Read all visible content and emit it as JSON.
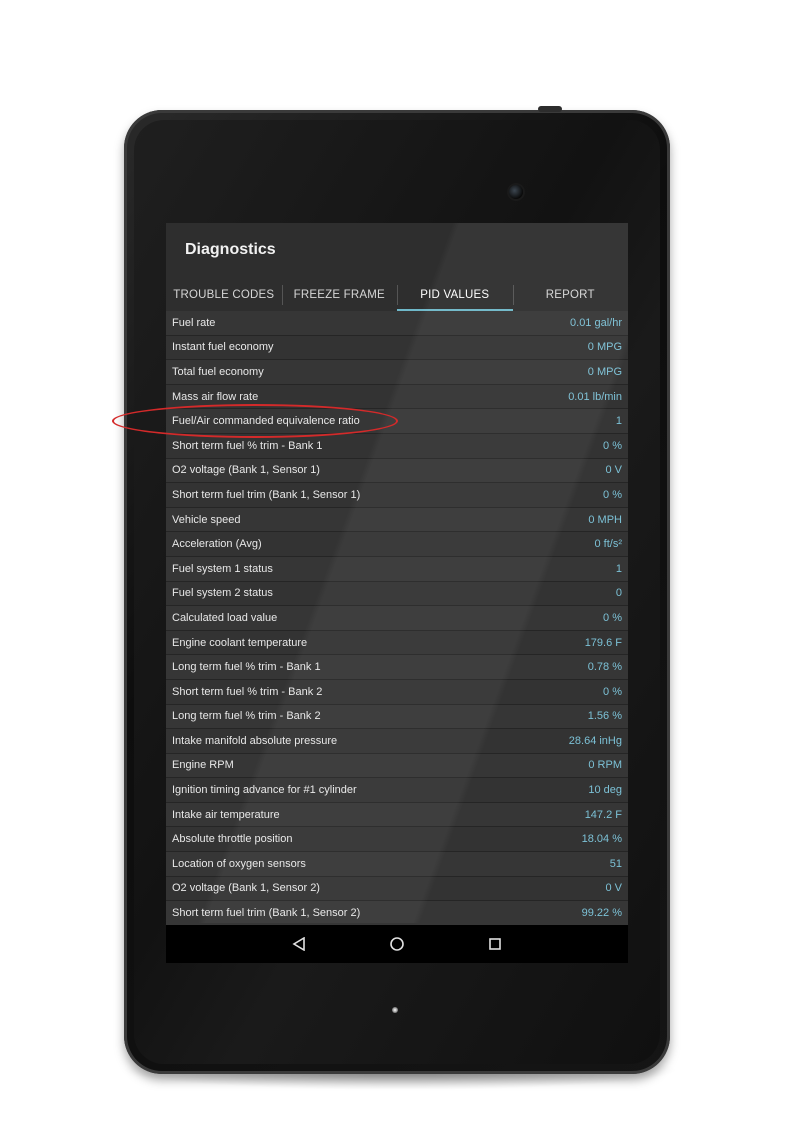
{
  "app": {
    "title": "Diagnostics"
  },
  "tabs": [
    {
      "label": "TROUBLE CODES",
      "active": false
    },
    {
      "label": "FREEZE FRAME",
      "active": false
    },
    {
      "label": "PID VALUES",
      "active": true
    },
    {
      "label": "REPORT",
      "active": false
    }
  ],
  "pid_rows": [
    {
      "label": "Fuel rate",
      "value": "0.01 gal/hr"
    },
    {
      "label": "Instant fuel economy",
      "value": "0 MPG"
    },
    {
      "label": "Total fuel economy",
      "value": "0 MPG"
    },
    {
      "label": "Mass air flow rate",
      "value": "0.01 lb/min"
    },
    {
      "label": "Fuel/Air commanded equivalence ratio",
      "value": "1"
    },
    {
      "label": "Short term fuel % trim - Bank 1",
      "value": "0 %"
    },
    {
      "label": "O2 voltage (Bank 1, Sensor 1)",
      "value": "0 V"
    },
    {
      "label": "Short term fuel trim (Bank 1, Sensor 1)",
      "value": "0 %"
    },
    {
      "label": "Vehicle speed",
      "value": "0 MPH"
    },
    {
      "label": "Acceleration (Avg)",
      "value": "0 ft/s²"
    },
    {
      "label": "Fuel system 1 status",
      "value": "1"
    },
    {
      "label": "Fuel system 2 status",
      "value": "0"
    },
    {
      "label": "Calculated load value",
      "value": "0 %"
    },
    {
      "label": "Engine coolant temperature",
      "value": "179.6 F"
    },
    {
      "label": "Long term fuel % trim - Bank 1",
      "value": "0.78 %"
    },
    {
      "label": "Short term fuel % trim - Bank 2",
      "value": "0 %"
    },
    {
      "label": "Long term fuel % trim - Bank 2",
      "value": "1.56 %"
    },
    {
      "label": "Intake manifold absolute pressure",
      "value": "28.64 inHg"
    },
    {
      "label": "Engine RPM",
      "value": "0 RPM"
    },
    {
      "label": "Ignition timing advance for #1 cylinder",
      "value": "10 deg"
    },
    {
      "label": "Intake air temperature",
      "value": "147.2 F"
    },
    {
      "label": "Absolute throttle position",
      "value": "18.04 %"
    },
    {
      "label": "Location of oxygen sensors",
      "value": "51"
    },
    {
      "label": "O2 voltage (Bank 1, Sensor 2)",
      "value": "0 V"
    },
    {
      "label": "Short term fuel trim (Bank 1, Sensor 2)",
      "value": "99.22 %"
    }
  ],
  "navbar": {
    "icons": [
      "back-icon",
      "home-icon",
      "recents-icon"
    ]
  },
  "colors": {
    "accent": "#6fb8c9",
    "value_text": "#7cc1d6",
    "highlight": "#d42a2a"
  }
}
